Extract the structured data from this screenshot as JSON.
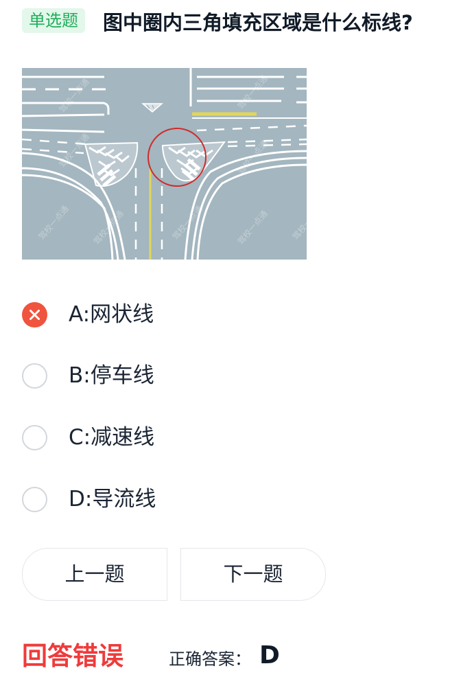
{
  "question": {
    "type_badge": "单选题",
    "text": "图中圈内三角填充区域是什么标线?"
  },
  "figure": {
    "watermark": "驾校一点通"
  },
  "options": [
    {
      "label": "A:网状线",
      "state": "wrong-selected"
    },
    {
      "label": "B:停车线",
      "state": "unselected"
    },
    {
      "label": "C:减速线",
      "state": "unselected"
    },
    {
      "label": "D:导流线",
      "state": "unselected"
    }
  ],
  "navigation": {
    "prev_label": "上一题",
    "next_label": "下一题"
  },
  "result": {
    "status": "回答错误",
    "answer_label": "正确答案：",
    "answer_value": "D"
  },
  "colors": {
    "badge_bg": "#e3f7ea",
    "badge_text": "#1fae5c",
    "wrong": "#f0533e",
    "result_text": "#ef3b3b",
    "road": "#a4b6bf",
    "circle": "#d02a2a",
    "yellow_line": "#e1d65c"
  }
}
